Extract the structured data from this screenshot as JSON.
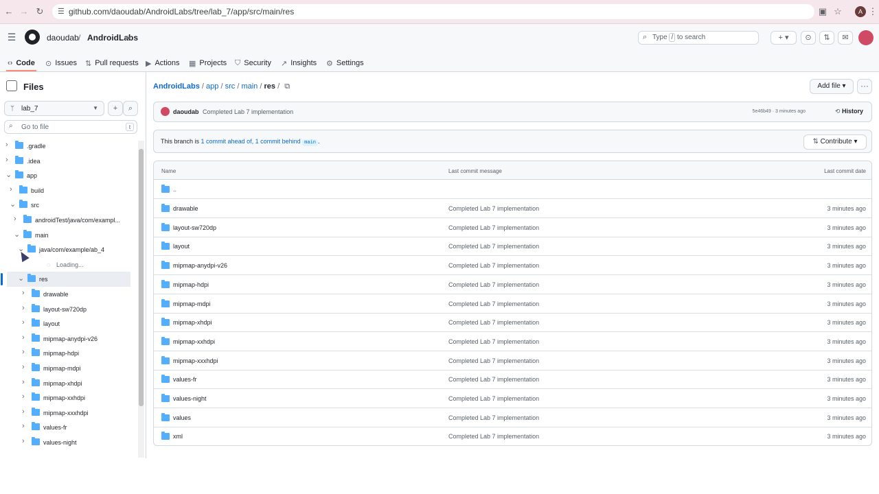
{
  "browser": {
    "url": "github.com/daoudab/AndroidLabs/tree/lab_7/app/src/main/res",
    "profile_initial": "A"
  },
  "header": {
    "owner": "daoudab",
    "separator": "/",
    "repo": "AndroidLabs",
    "search_placeholder_prefix": "Type",
    "search_key": "/",
    "search_placeholder_suffix": "to search",
    "plus": "+"
  },
  "tabs": [
    {
      "label": "Code",
      "icon": "code-icon"
    },
    {
      "label": "Issues",
      "icon": "issue-icon"
    },
    {
      "label": "Pull requests",
      "icon": "pull-request-icon"
    },
    {
      "label": "Actions",
      "icon": "play-icon"
    },
    {
      "label": "Projects",
      "icon": "table-icon"
    },
    {
      "label": "Security",
      "icon": "shield-icon"
    },
    {
      "label": "Insights",
      "icon": "graph-icon"
    },
    {
      "label": "Settings",
      "icon": "gear-icon"
    }
  ],
  "sidebar": {
    "title": "Files",
    "branch": "lab_7",
    "goto_placeholder": "Go to file",
    "goto_key": "t",
    "tree": [
      {
        "label": ".gradle",
        "depth": 0,
        "expanded": false
      },
      {
        "label": ".idea",
        "depth": 0,
        "expanded": false
      },
      {
        "label": "app",
        "depth": 0,
        "expanded": true
      },
      {
        "label": "build",
        "depth": 1,
        "expanded": false
      },
      {
        "label": "src",
        "depth": 1,
        "expanded": true
      },
      {
        "label": "androidTest/java/com/exampl...",
        "depth": 2,
        "expanded": false
      },
      {
        "label": "main",
        "depth": 2,
        "expanded": true
      },
      {
        "label": "java/com/example/ab_4",
        "depth": 3,
        "expanded": true
      },
      {
        "label": "Loading...",
        "depth": 4,
        "loading": true
      },
      {
        "label": "res",
        "depth": 3,
        "expanded": true,
        "selected": true
      },
      {
        "label": "drawable",
        "depth": 4,
        "expanded": false
      },
      {
        "label": "layout-sw720dp",
        "depth": 4,
        "expanded": false
      },
      {
        "label": "layout",
        "depth": 4,
        "expanded": false
      },
      {
        "label": "mipmap-anydpi-v26",
        "depth": 4,
        "expanded": false
      },
      {
        "label": "mipmap-hdpi",
        "depth": 4,
        "expanded": false
      },
      {
        "label": "mipmap-mdpi",
        "depth": 4,
        "expanded": false
      },
      {
        "label": "mipmap-xhdpi",
        "depth": 4,
        "expanded": false
      },
      {
        "label": "mipmap-xxhdpi",
        "depth": 4,
        "expanded": false
      },
      {
        "label": "mipmap-xxxhdpi",
        "depth": 4,
        "expanded": false
      },
      {
        "label": "values-fr",
        "depth": 4,
        "expanded": false
      },
      {
        "label": "values-night",
        "depth": 4,
        "expanded": false
      }
    ]
  },
  "main": {
    "breadcrumb": [
      "AndroidLabs",
      "app",
      "src",
      "main",
      "res"
    ],
    "add_file": "Add file",
    "commit": {
      "author": "daoudab",
      "message": "Completed Lab 7 implementation",
      "meta": "5e46b49 · 3 minutes ago",
      "history": "History"
    },
    "branch_status": {
      "prefix": "This branch is",
      "ahead": "1 commit ahead of,",
      "behind": "1 commit behind",
      "base": "main",
      "suffix": ".",
      "contribute": "Contribute"
    },
    "columns": [
      "Name",
      "Last commit message",
      "Last commit date"
    ],
    "parent": "..",
    "rows": [
      {
        "name": "drawable",
        "message": "Completed Lab 7 implementation",
        "date": "3 minutes ago"
      },
      {
        "name": "layout-sw720dp",
        "message": "Completed Lab 7 implementation",
        "date": "3 minutes ago"
      },
      {
        "name": "layout",
        "message": "Completed Lab 7 implementation",
        "date": "3 minutes ago"
      },
      {
        "name": "mipmap-anydpi-v26",
        "message": "Completed Lab 7 implementation",
        "date": "3 minutes ago"
      },
      {
        "name": "mipmap-hdpi",
        "message": "Completed Lab 7 implementation",
        "date": "3 minutes ago"
      },
      {
        "name": "mipmap-mdpi",
        "message": "Completed Lab 7 implementation",
        "date": "3 minutes ago"
      },
      {
        "name": "mipmap-xhdpi",
        "message": "Completed Lab 7 implementation",
        "date": "3 minutes ago"
      },
      {
        "name": "mipmap-xxhdpi",
        "message": "Completed Lab 7 implementation",
        "date": "3 minutes ago"
      },
      {
        "name": "mipmap-xxxhdpi",
        "message": "Completed Lab 7 implementation",
        "date": "3 minutes ago"
      },
      {
        "name": "values-fr",
        "message": "Completed Lab 7 implementation",
        "date": "3 minutes ago"
      },
      {
        "name": "values-night",
        "message": "Completed Lab 7 implementation",
        "date": "3 minutes ago"
      },
      {
        "name": "values",
        "message": "Completed Lab 7 implementation",
        "date": "3 minutes ago"
      },
      {
        "name": "xml",
        "message": "Completed Lab 7 implementation",
        "date": "3 minutes ago"
      }
    ]
  },
  "colors": {
    "accent": "#0969da",
    "folder": "#54aeff",
    "tab_underline": "#fd8c73"
  }
}
